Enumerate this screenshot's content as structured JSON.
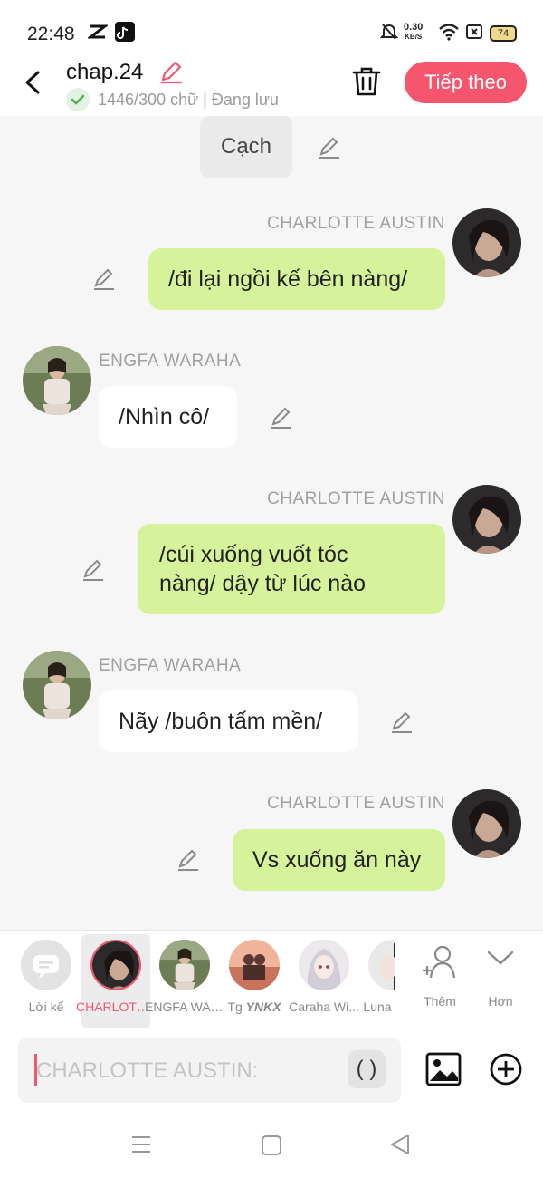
{
  "status_bar": {
    "time": "22:48",
    "speed_value": "0.30",
    "speed_unit": "KB/S",
    "battery": "74",
    "icons": [
      "capcut-icon",
      "tiktok-icon",
      "mute-bell-icon",
      "wifi-icon",
      "close-box-icon"
    ]
  },
  "header": {
    "title": "chap.24",
    "status": "1446/300 chữ | Đang lưu",
    "next_label": "Tiếp theo",
    "accent": "#f5566e"
  },
  "chat": {
    "top_item": "Cạch",
    "messages": [
      {
        "speaker": "CHARLOTTE AUSTIN",
        "side": "right",
        "text": "/đi lại ngồi kế bên nàng/"
      },
      {
        "speaker": "ENGFA WARAHA",
        "side": "left",
        "text": "/Nhìn cô/"
      },
      {
        "speaker": "CHARLOTTE AUSTIN",
        "side": "right",
        "text_line1": "/cúi xuống vuốt tóc",
        "text_line2": "nàng/ dậy từ lúc nào"
      },
      {
        "speaker": "ENGFA WARAHA",
        "side": "left",
        "text": "Nãy /buôn tấm mền/"
      },
      {
        "speaker": "CHARLOTTE AUSTIN",
        "side": "right",
        "text": "Vs xuống ăn này"
      }
    ],
    "bubble_green": "#d6f29a"
  },
  "characters": [
    {
      "label": "Lời kể"
    },
    {
      "label": "CHARLOTTE AUSTIN",
      "selected": true
    },
    {
      "label": "ENGFA WARAHA"
    },
    {
      "label_prefix": "Tg",
      "label_bold": "YNKX"
    },
    {
      "label": "Caraha Wi..."
    },
    {
      "label": "Luna"
    },
    {
      "label": "Thêm"
    },
    {
      "label": "Hơn"
    }
  ],
  "input": {
    "placeholder": "CHARLOTTE AUSTIN:",
    "paren": "( )"
  }
}
